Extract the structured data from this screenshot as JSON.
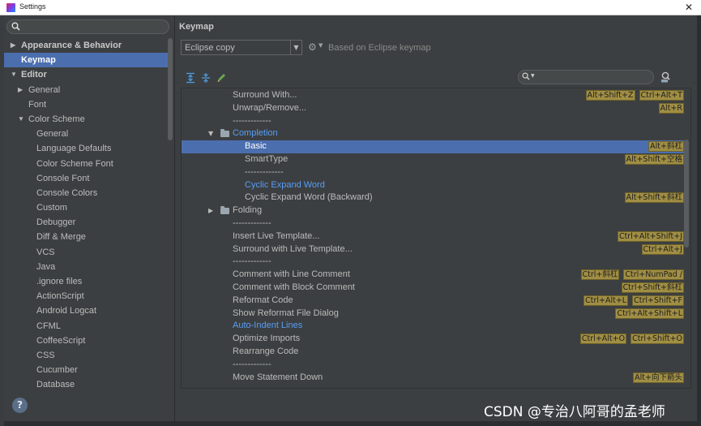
{
  "window": {
    "title": "Settings",
    "close": "✕"
  },
  "search": {
    "icon": "search-icon",
    "placeholder": ""
  },
  "sidebar": {
    "items": [
      {
        "label": "Appearance & Behavior",
        "level": 0,
        "arrow": "▶",
        "bold": true,
        "selected": false
      },
      {
        "label": "Keymap",
        "level": 0,
        "arrow": "",
        "bold": true,
        "selected": true
      },
      {
        "label": "Editor",
        "level": 0,
        "arrow": "▼",
        "bold": true,
        "selected": false
      },
      {
        "label": "General",
        "level": 1,
        "arrow": "▶",
        "bold": false,
        "selected": false
      },
      {
        "label": "Font",
        "level": 1,
        "arrow": "",
        "bold": false,
        "selected": false
      },
      {
        "label": "Color Scheme",
        "level": 1,
        "arrow": "▼",
        "bold": false,
        "selected": false
      },
      {
        "label": "General",
        "level": 2,
        "arrow": "",
        "bold": false,
        "selected": false
      },
      {
        "label": "Language Defaults",
        "level": 2,
        "arrow": "",
        "bold": false,
        "selected": false
      },
      {
        "label": "Color Scheme Font",
        "level": 2,
        "arrow": "",
        "bold": false,
        "selected": false
      },
      {
        "label": "Console Font",
        "level": 2,
        "arrow": "",
        "bold": false,
        "selected": false
      },
      {
        "label": "Console Colors",
        "level": 2,
        "arrow": "",
        "bold": false,
        "selected": false
      },
      {
        "label": "Custom",
        "level": 2,
        "arrow": "",
        "bold": false,
        "selected": false
      },
      {
        "label": "Debugger",
        "level": 2,
        "arrow": "",
        "bold": false,
        "selected": false
      },
      {
        "label": "Diff & Merge",
        "level": 2,
        "arrow": "",
        "bold": false,
        "selected": false
      },
      {
        "label": "VCS",
        "level": 2,
        "arrow": "",
        "bold": false,
        "selected": false
      },
      {
        "label": "Java",
        "level": 2,
        "arrow": "",
        "bold": false,
        "selected": false
      },
      {
        "label": ".ignore files",
        "level": 2,
        "arrow": "",
        "bold": false,
        "selected": false
      },
      {
        "label": "ActionScript",
        "level": 2,
        "arrow": "",
        "bold": false,
        "selected": false
      },
      {
        "label": "Android Logcat",
        "level": 2,
        "arrow": "",
        "bold": false,
        "selected": false
      },
      {
        "label": "CFML",
        "level": 2,
        "arrow": "",
        "bold": false,
        "selected": false
      },
      {
        "label": "CoffeeScript",
        "level": 2,
        "arrow": "",
        "bold": false,
        "selected": false
      },
      {
        "label": "CSS",
        "level": 2,
        "arrow": "",
        "bold": false,
        "selected": false
      },
      {
        "label": "Cucumber",
        "level": 2,
        "arrow": "",
        "bold": false,
        "selected": false
      },
      {
        "label": "Database",
        "level": 2,
        "arrow": "",
        "bold": false,
        "selected": false
      }
    ]
  },
  "help": {
    "label": "?"
  },
  "keymap": {
    "title": "Keymap",
    "scheme": "Eclipse copy",
    "based_on": "Based on Eclipse keymap",
    "filter_placeholder": ""
  },
  "actions": [
    {
      "label": "Surround With...",
      "indent": 2,
      "shortcuts": [
        "Alt+Shift+Z",
        "Ctrl+Alt+T"
      ]
    },
    {
      "label": "Unwrap/Remove...",
      "indent": 2,
      "shortcuts": [
        "Alt+R"
      ]
    },
    {
      "label": "-------------",
      "indent": 2,
      "shortcuts": []
    },
    {
      "label": "Completion",
      "indent": 2,
      "arrow": "▼",
      "folder": true,
      "blue": true,
      "shortcuts": []
    },
    {
      "label": "Basic",
      "indent": 3,
      "selected": true,
      "shortcuts": [
        "Alt+斜杠"
      ]
    },
    {
      "label": "SmartType",
      "indent": 3,
      "shortcuts": [
        "Alt+Shift+空格"
      ]
    },
    {
      "label": "-------------",
      "indent": 3,
      "shortcuts": []
    },
    {
      "label": "Cyclic Expand Word",
      "indent": 3,
      "blue": true,
      "shortcuts": []
    },
    {
      "label": "Cyclic Expand Word (Backward)",
      "indent": 3,
      "shortcuts": [
        "Alt+Shift+斜杠"
      ]
    },
    {
      "label": "Folding",
      "indent": 2,
      "arrow": "▶",
      "folder": true,
      "shortcuts": []
    },
    {
      "label": "-------------",
      "indent": 2,
      "shortcuts": []
    },
    {
      "label": "Insert Live Template...",
      "indent": 2,
      "shortcuts": [
        "Ctrl+Alt+Shift+J"
      ]
    },
    {
      "label": "Surround with Live Template...",
      "indent": 2,
      "shortcuts": [
        "Ctrl+Alt+J"
      ]
    },
    {
      "label": "-------------",
      "indent": 2,
      "shortcuts": []
    },
    {
      "label": "Comment with Line Comment",
      "indent": 2,
      "shortcuts": [
        "Ctrl+斜杠",
        "Ctrl+NumPad /"
      ]
    },
    {
      "label": "Comment with Block Comment",
      "indent": 2,
      "shortcuts": [
        "Ctrl+Shift+斜杠"
      ]
    },
    {
      "label": "Reformat Code",
      "indent": 2,
      "shortcuts": [
        "Ctrl+Alt+L",
        "Ctrl+Shift+F"
      ]
    },
    {
      "label": "Show Reformat File Dialog",
      "indent": 2,
      "shortcuts": [
        "Ctrl+Alt+Shift+L"
      ]
    },
    {
      "label": "Auto-Indent Lines",
      "indent": 2,
      "blue": true,
      "shortcuts": []
    },
    {
      "label": "Optimize Imports",
      "indent": 2,
      "shortcuts": [
        "Ctrl+Alt+O",
        "Ctrl+Shift+O"
      ]
    },
    {
      "label": "Rearrange Code",
      "indent": 2,
      "shortcuts": []
    },
    {
      "label": "-------------",
      "indent": 2,
      "shortcuts": []
    },
    {
      "label": "Move Statement Down",
      "indent": 2,
      "shortcuts": [
        "Alt+向下箭头"
      ]
    }
  ],
  "toolbar": {
    "icons": [
      "expand-all-icon",
      "collapse-all-icon",
      "edit-icon"
    ]
  },
  "watermark": "CSDN @专治八阿哥的孟老师",
  "colors": {
    "selection": "#4b6eaf",
    "shortcut_bg": "#a08e44",
    "link_blue": "#589df6",
    "panel": "#3c3f41"
  }
}
